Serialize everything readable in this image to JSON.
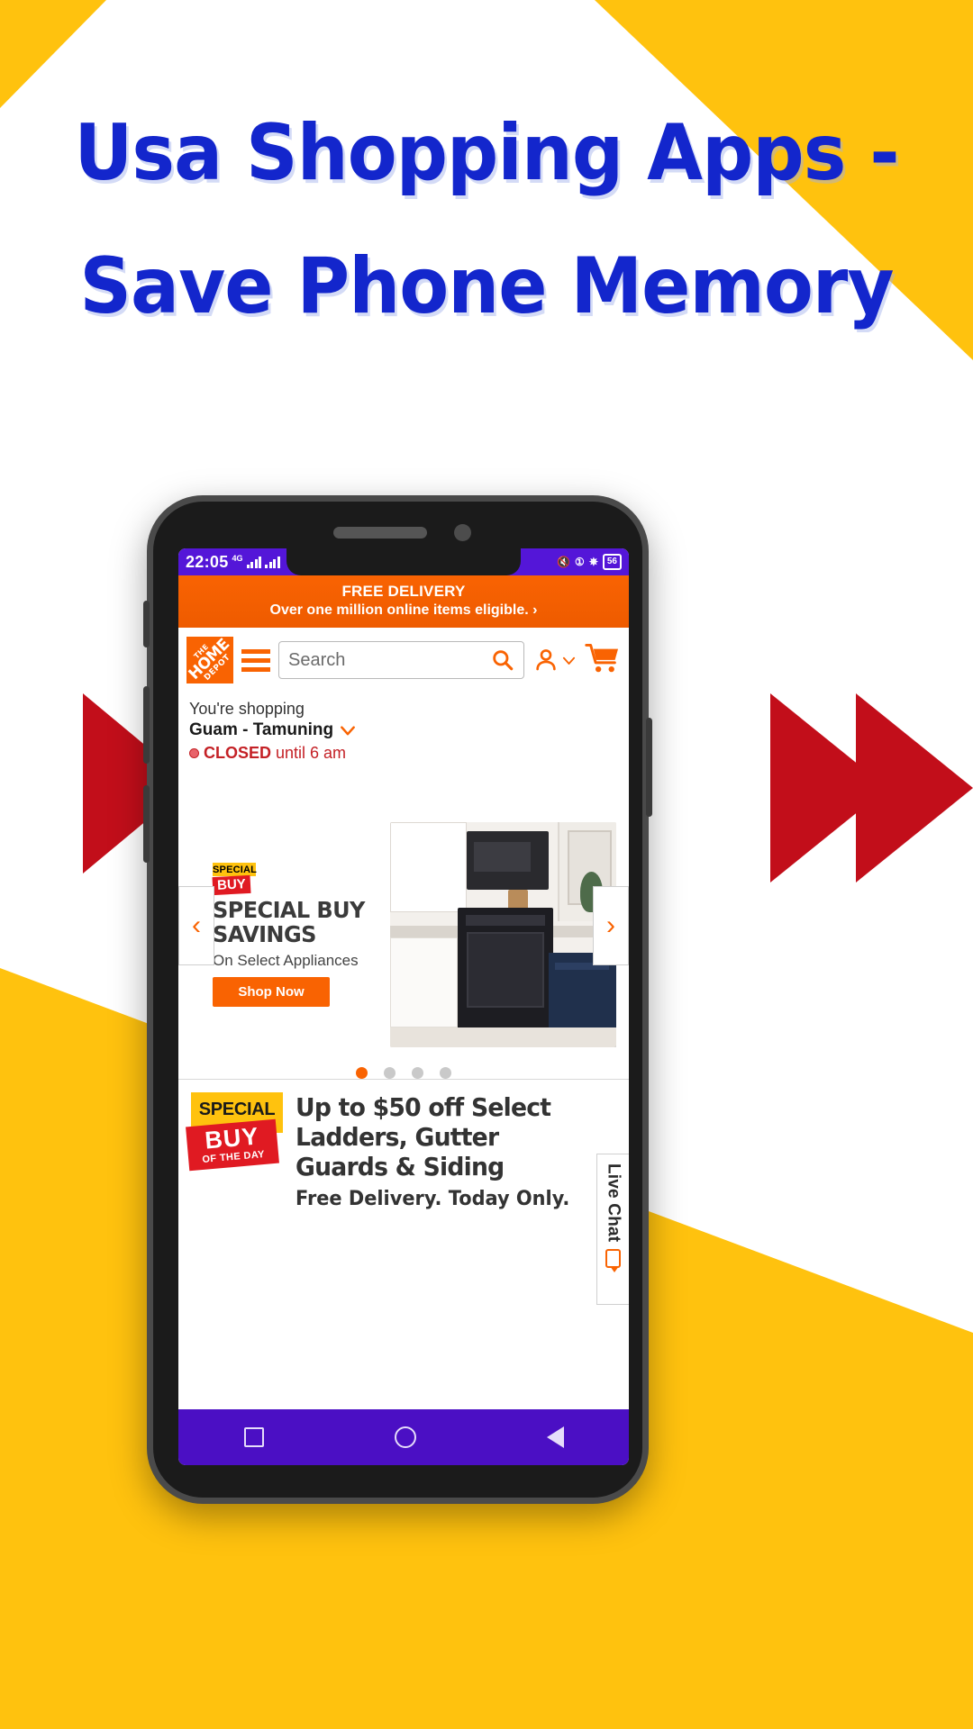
{
  "poster": {
    "headline_line1": "Usa Shopping Apps -",
    "headline_line2": "Save Phone Memory",
    "headline_color": "#1326CC",
    "accent_yellow": "#FFC20E",
    "accent_red": "#C20E1A"
  },
  "status_bar": {
    "time": "22:05",
    "network": "4G",
    "battery": "56",
    "bg_color": "#5416D8"
  },
  "promo_banner": {
    "title": "FREE DELIVERY",
    "subtitle": "Over one million online items eligible.",
    "chevron": "›",
    "bg_color": "#F96302"
  },
  "app_header": {
    "logo_line1": "THE",
    "logo_line2": "HOME",
    "logo_line3": "DEPOT",
    "menu_icon": "hamburger-icon",
    "search_placeholder": "Search",
    "search_value": "",
    "account_icon": "person-icon",
    "account_chevron": "⌄",
    "cart_icon": "cart-icon"
  },
  "store": {
    "prefix": "You're shopping",
    "name": "Guam - Tamuning",
    "chevron": "⌄",
    "status": "CLOSED",
    "status_detail": "until 6 am",
    "status_color": "#C42126"
  },
  "carousel": {
    "badge_top": "SPECIAL",
    "badge_bottom": "BUY",
    "headline_line1": "SPECIAL BUY",
    "headline_line2": "SAVINGS",
    "subtitle": "On Select Appliances",
    "cta": "Shop Now",
    "prev_icon": "‹",
    "next_icon": "›",
    "dots_total": 4,
    "dot_active": 1
  },
  "live_chat": {
    "label": "Live Chat",
    "icon": "chat-bubble-icon"
  },
  "special_buy_of_day": {
    "badge_top": "SPECIAL",
    "badge_mid": "BUY",
    "badge_bottom": "OF THE DAY",
    "headline_line1": "Up to $50 off Select",
    "headline_line2": "Ladders, Gutter",
    "headline_line3": "Guards & Siding",
    "subtitle": "Free Delivery. Today Only."
  },
  "nav_bar": {
    "recent_label": "recent-apps",
    "home_label": "home",
    "back_label": "back",
    "bg_color": "#4B0FC4"
  }
}
